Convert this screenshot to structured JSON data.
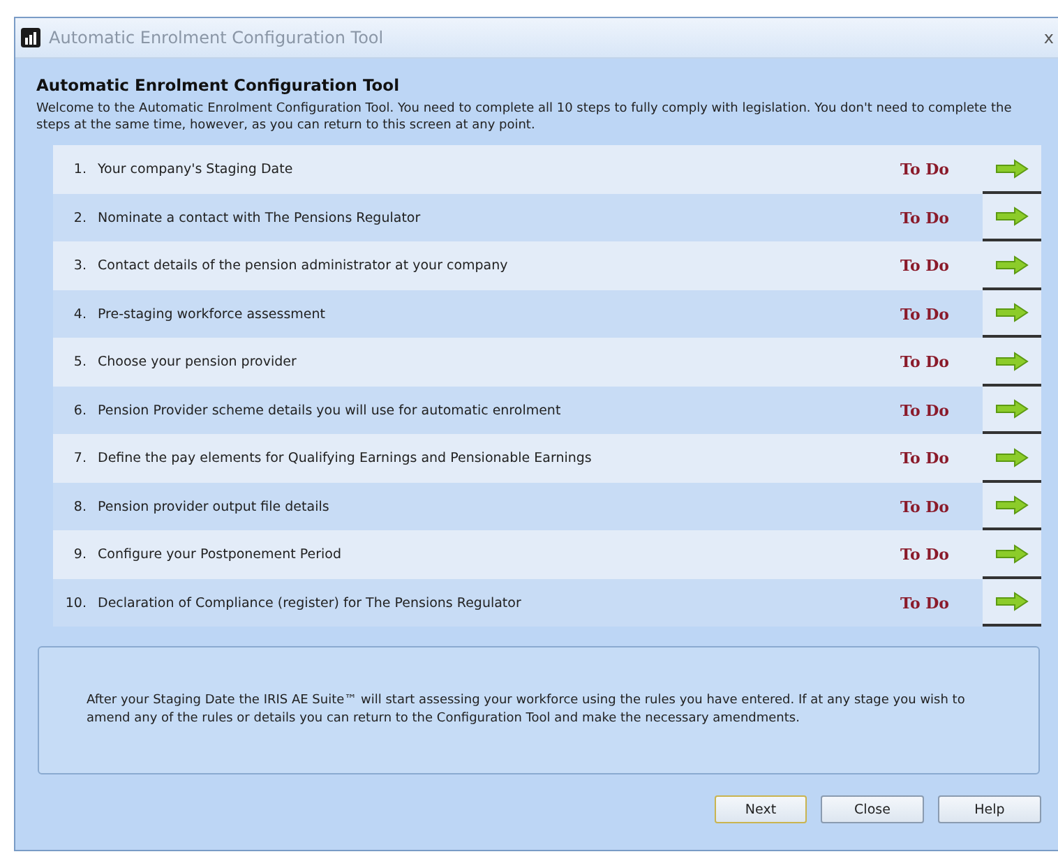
{
  "window": {
    "title": "Automatic Enrolment Configuration Tool",
    "close": "x"
  },
  "heading": "Automatic Enrolment Configuration Tool",
  "intro": "Welcome to the Automatic Enrolment Configuration Tool.  You need to complete all 10 steps to fully comply with legislation.  You don't need to complete the steps at the same time, however, as you can return to this screen at any point.",
  "steps": [
    {
      "number": "1.",
      "label": "Your company's Staging Date",
      "status": "To Do"
    },
    {
      "number": "2.",
      "label": "Nominate a contact with The Pensions Regulator",
      "status": "To Do"
    },
    {
      "number": "3.",
      "label": "Contact details of the pension administrator at your company",
      "status": "To Do"
    },
    {
      "number": "4.",
      "label": "Pre-staging workforce assessment",
      "status": "To Do"
    },
    {
      "number": "5.",
      "label": "Choose your pension provider",
      "status": "To Do"
    },
    {
      "number": "6.",
      "label": "Pension Provider scheme details you will use for automatic enrolment",
      "status": "To Do"
    },
    {
      "number": "7.",
      "label": "Define the pay elements for Qualifying Earnings and Pensionable Earnings",
      "status": "To Do"
    },
    {
      "number": "8.",
      "label": "Pension provider output file details",
      "status": "To Do"
    },
    {
      "number": "9.",
      "label": "Configure your Postponement Period",
      "status": "To Do"
    },
    {
      "number": "10.",
      "label": "Declaration of Compliance (register) for The Pensions Regulator",
      "status": "To Do"
    }
  ],
  "info": "After your Staging Date the IRIS AE Suite™ will start assessing your workforce using the rules you have entered.  If at any stage you wish to amend any of the rules or details you can return to the Configuration Tool and make the necessary amendments.",
  "buttons": [
    {
      "label": "Next",
      "selected": true
    },
    {
      "label": "Close",
      "selected": false
    },
    {
      "label": "Help",
      "selected": false
    }
  ]
}
